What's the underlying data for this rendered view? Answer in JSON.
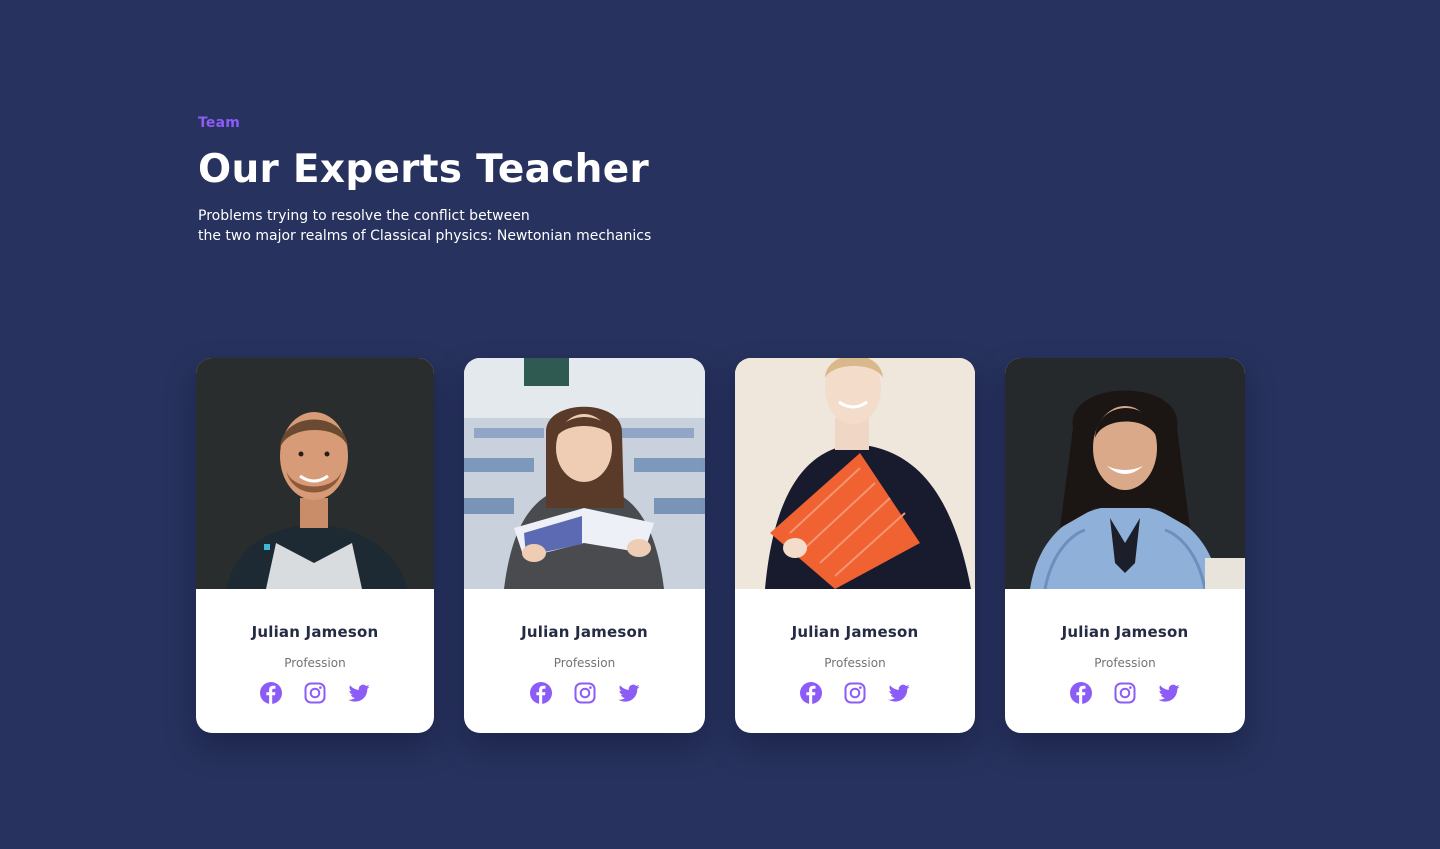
{
  "section": {
    "eyebrow": "Team",
    "title": "Our Experts Teacher",
    "subtitle_line1": "Problems trying to resolve the conflict between",
    "subtitle_line2": "the two major realms of Classical physics: Newtonian mechanics"
  },
  "colors": {
    "background": "#27325e",
    "accent": "#8b5cf6",
    "name_text": "#252b42",
    "muted_text": "#737373"
  },
  "teachers": [
    {
      "name": "Julian Jameson",
      "profession": "Profession",
      "socials": [
        "facebook-icon",
        "instagram-icon",
        "twitter-icon"
      ]
    },
    {
      "name": "Julian Jameson",
      "profession": "Profession",
      "socials": [
        "facebook-icon",
        "instagram-icon",
        "twitter-icon"
      ]
    },
    {
      "name": "Julian Jameson",
      "profession": "Profession",
      "socials": [
        "facebook-icon",
        "instagram-icon",
        "twitter-icon"
      ]
    },
    {
      "name": "Julian Jameson",
      "profession": "Profession",
      "socials": [
        "facebook-icon",
        "instagram-icon",
        "twitter-icon"
      ]
    }
  ]
}
